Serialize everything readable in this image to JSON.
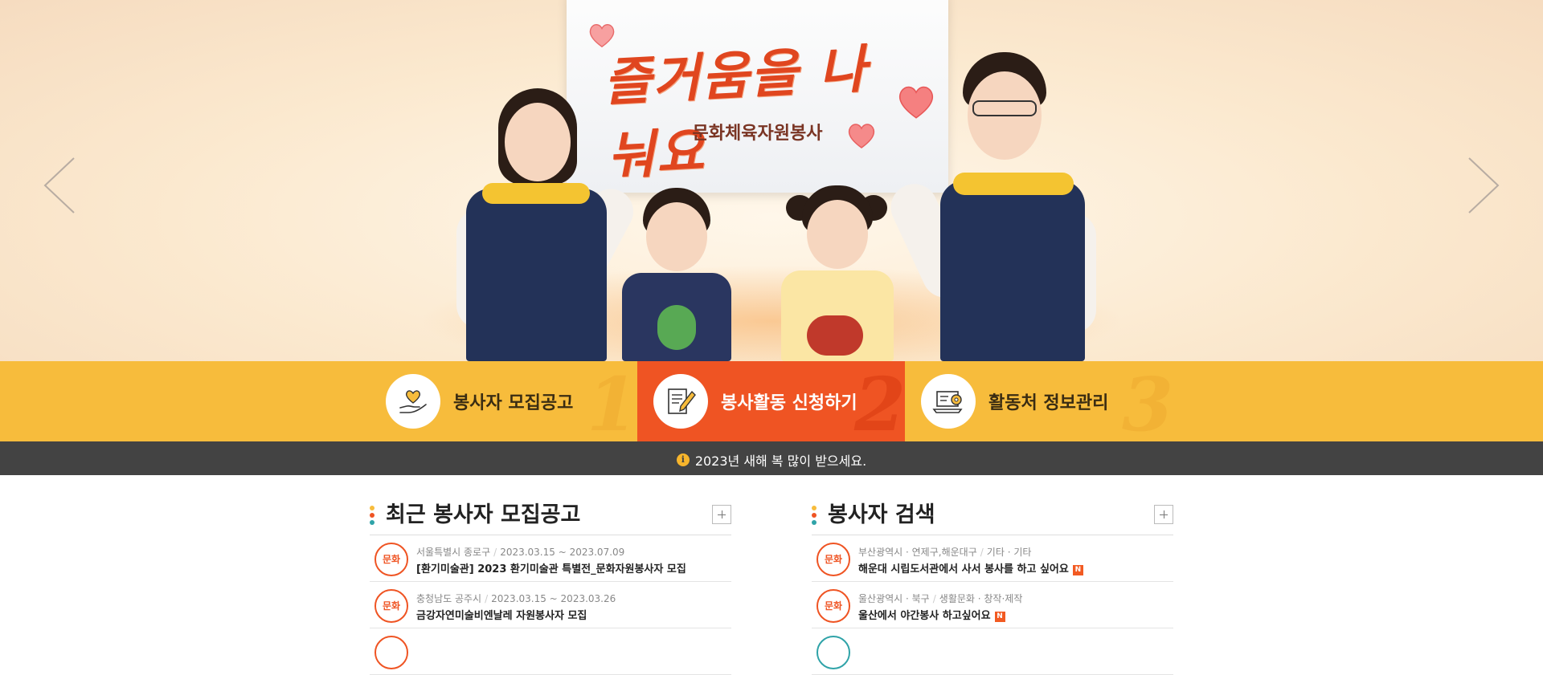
{
  "hero": {
    "board_title": "즐거움을 나눠요",
    "board_subtitle": "문화체육자원봉사",
    "prev_icon": "chevron-left-icon",
    "next_icon": "chevron-right-icon"
  },
  "quick_menu": [
    {
      "label": "봉사자 모집공고",
      "number": "1",
      "icon": "heart-hand-icon"
    },
    {
      "label": "봉사활동 신청하기",
      "number": "2",
      "icon": "form-pencil-icon",
      "active": true
    },
    {
      "label": "활동처 정보관리",
      "number": "3",
      "icon": "laptop-gear-icon"
    }
  ],
  "notice": {
    "icon": "info-icon",
    "text": "2023년 새해 복 많이 받으세요."
  },
  "recent_recruits": {
    "title": "최근 봉사자 모집공고",
    "items": [
      {
        "badge": "문화",
        "region": "서울특별시 종로구",
        "period": "2023.03.15 ~ 2023.07.09",
        "title": "[환기미술관] 2023 환기미술관 특별전_문화자원봉사자 모집"
      },
      {
        "badge": "문화",
        "region": "충청남도 공주시",
        "period": "2023.03.15 ~ 2023.03.26",
        "title": "금강자연미술비엔날레 자원봉사자 모집"
      }
    ]
  },
  "volunteer_search": {
    "title": "봉사자 검색",
    "items": [
      {
        "badge": "문화",
        "region": "부산광역시 · 연제구,해운대구",
        "category": "기타 · 기타",
        "title": "해운대 시립도서관에서 사서 봉사를 하고 싶어요",
        "new_label": "N"
      },
      {
        "badge": "문화",
        "region": "울산광역시 · 북구",
        "category": "생활문화 · 창작·제작",
        "title": "울산에서 야간봉사 하고싶어요",
        "new_label": "N"
      }
    ]
  },
  "colors": {
    "accent_orange": "#ef5423",
    "accent_yellow": "#f7bc3c",
    "notice_bg": "#434343"
  }
}
